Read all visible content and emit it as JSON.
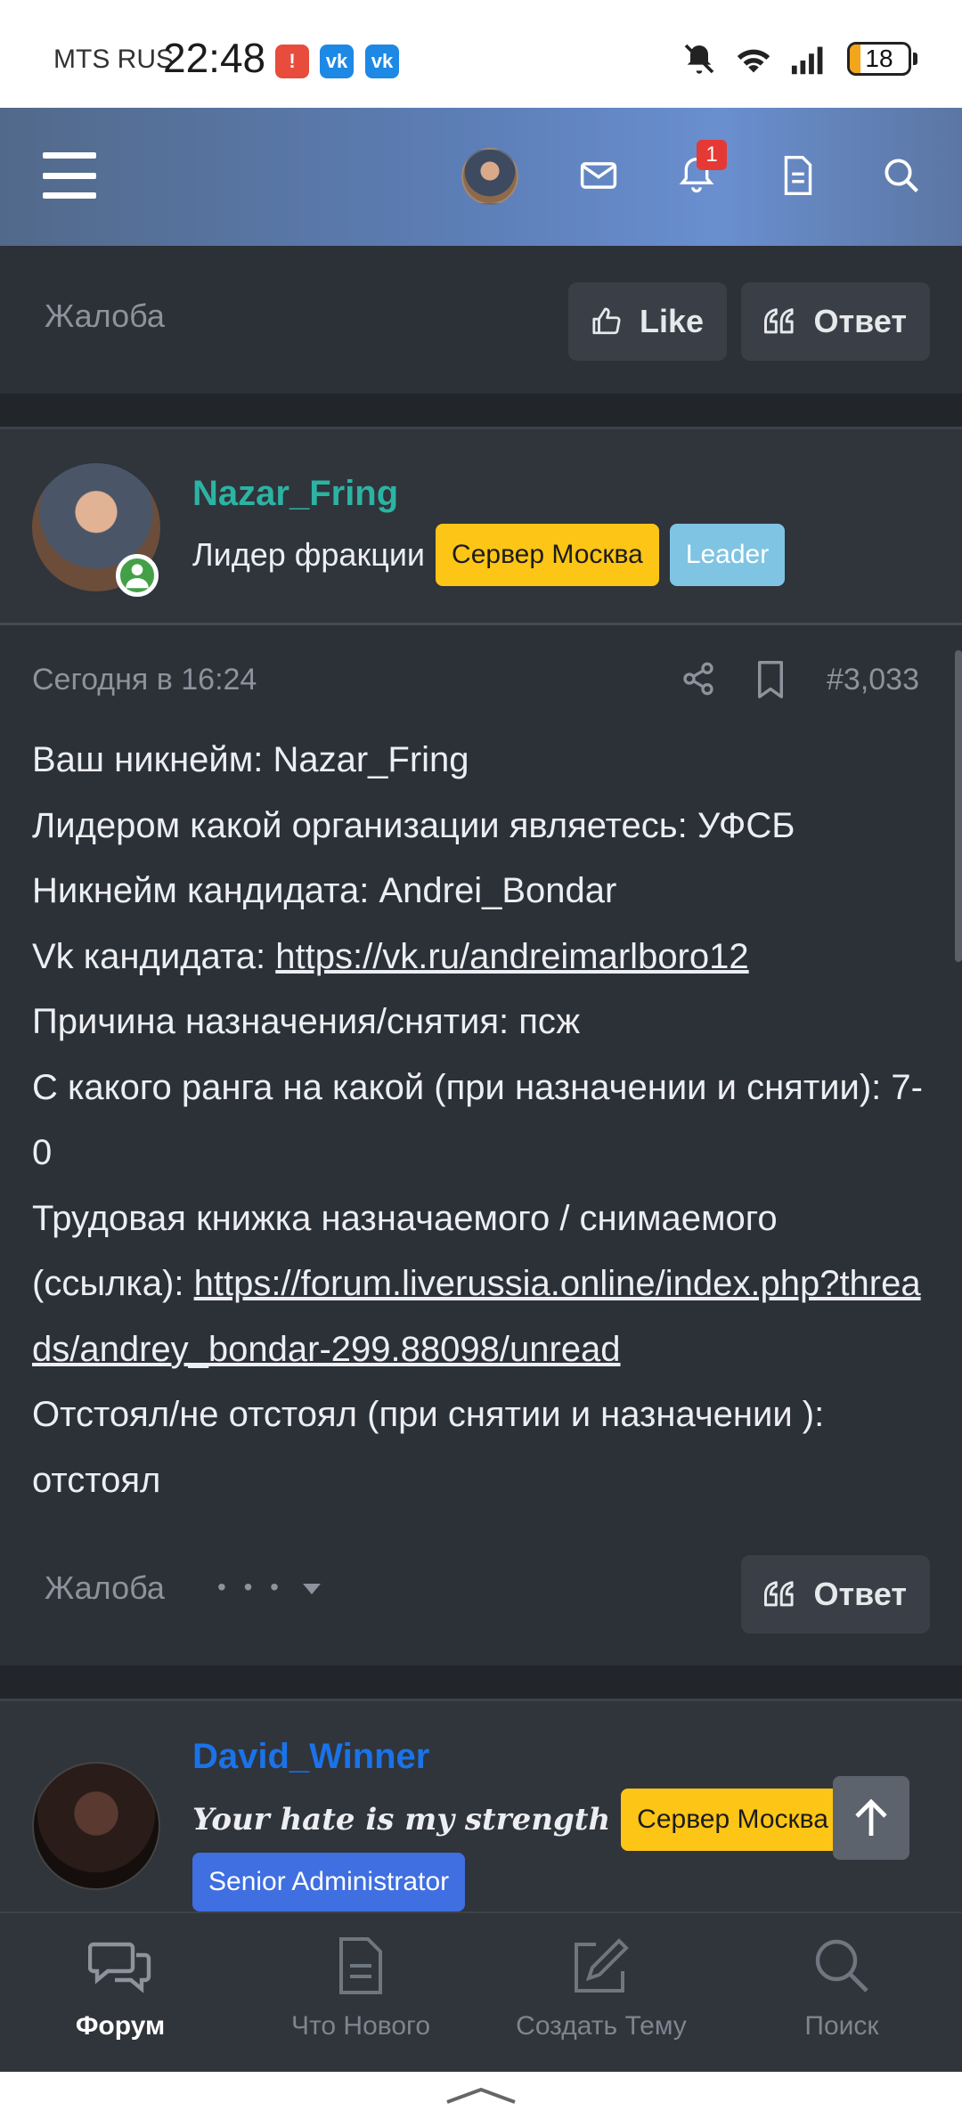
{
  "status_bar": {
    "carrier": "MTS RUS",
    "time": "22:48",
    "battery": "18",
    "battery_level_pct": 18,
    "badges": [
      {
        "icon": "notification-app-icon",
        "color": "#e74c3c"
      },
      {
        "icon": "vk-icon",
        "label": "vk",
        "color": "#1e88e5"
      },
      {
        "icon": "vk-icon",
        "label": "vk",
        "color": "#1e88e5"
      }
    ]
  },
  "header": {
    "notifications_count": "1",
    "icons": [
      "menu-icon",
      "user-avatar",
      "mail-icon",
      "bell-icon",
      "document-icon",
      "search-icon"
    ]
  },
  "post1": {
    "report": "Жалоба",
    "like": "Like",
    "reply": "Ответ"
  },
  "post2": {
    "username": "Nazar_Fring",
    "username_color": "#2bb3a3",
    "title": "Лидер фракции",
    "badge_server": "Сервер Москва",
    "badge_leader": "Leader",
    "time": "Сегодня в 16:24",
    "number": "#3,033",
    "lines": {
      "l1": "Ваш никнейм: Nazar_Fring",
      "l2": "Лидером какой организации являетесь: УФСБ",
      "l3": "Никнейм кандидата: Andrei_Bondar",
      "l4_label": "Vk кандидата: ",
      "l4_link": "https://vk.ru/andreimarlboro12",
      "l5": "Причина назначения/снятия: псж",
      "l6": "С какого ранга на какой (при назначении и снятии): 7-0",
      "l7_label": "Трудовая книжка назначаемого / снимаемого (ссылка): ",
      "l7_link": "https://forum.liverussia.online/index.php?threads/andrey_bondar-299.88098/unread",
      "l8": "Отстоял/не отстоял (при снятии и назначении ): отстоял"
    },
    "report": "Жалоба",
    "more": "• • •",
    "reply": "Ответ"
  },
  "post3": {
    "username": "David_Winner",
    "username_color": "#1a73e8",
    "title": "Your hate is my strength",
    "badge_server": "Сервер Москва",
    "badge_role": "Senior Administrator"
  },
  "bottom_nav": {
    "items": [
      {
        "label": "Форум",
        "icon": "forum-icon",
        "active": true
      },
      {
        "label": "Что Нового",
        "icon": "document-icon",
        "active": false
      },
      {
        "label": "Создать Тему",
        "icon": "edit-icon",
        "active": false
      },
      {
        "label": "Поиск",
        "icon": "search-icon",
        "active": false
      }
    ]
  },
  "colors": {
    "badge_server": "#fdc516",
    "badge_leader": "#7fc4e3",
    "badge_admin": "#3f6fe0"
  }
}
